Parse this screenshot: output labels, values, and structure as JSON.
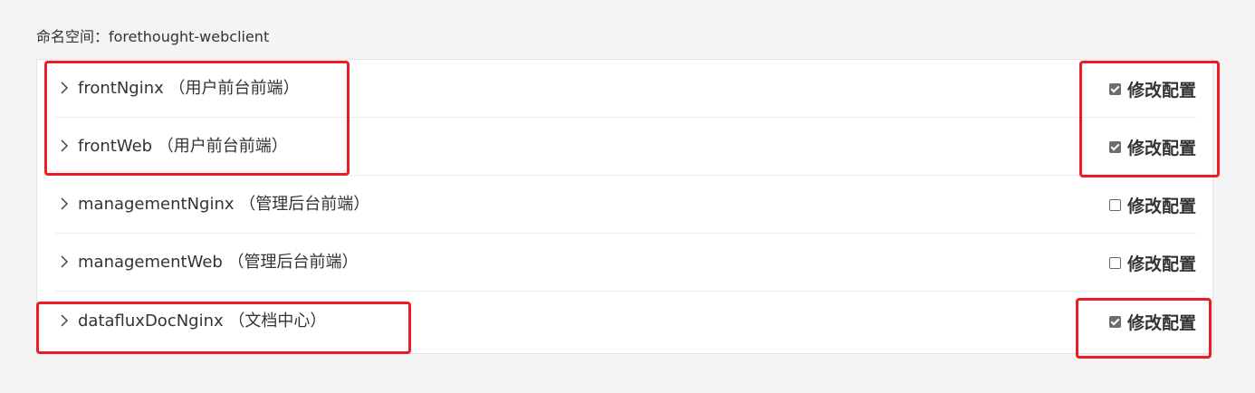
{
  "namespace": {
    "label": "命名空间：forethought-webclient"
  },
  "rows": [
    {
      "name": "frontNginx （用户前台前端）",
      "checkbox_label": "修改配置",
      "checked": true
    },
    {
      "name": "frontWeb （用户前台前端）",
      "checkbox_label": "修改配置",
      "checked": true
    },
    {
      "name": "managementNginx （管理后台前端）",
      "checkbox_label": "修改配置",
      "checked": false
    },
    {
      "name": "managementWeb （管理后台前端）",
      "checkbox_label": "修改配置",
      "checked": false
    },
    {
      "name": "datafluxDocNginx （文档中心）",
      "checkbox_label": "修改配置",
      "checked": true
    }
  ],
  "colors": {
    "highlight": "#ec1c24",
    "checkbox_checked": "#6e6e6e"
  }
}
